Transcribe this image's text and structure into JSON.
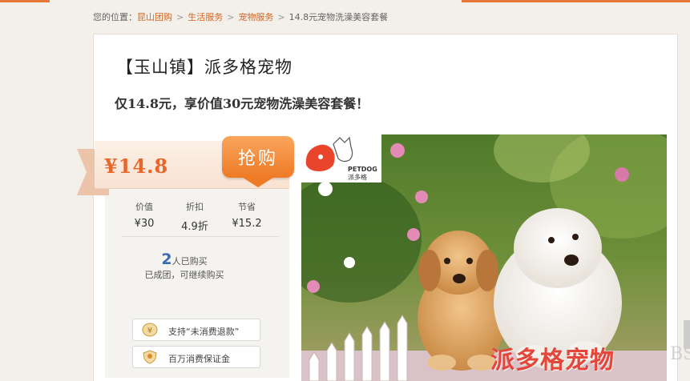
{
  "breadcrumb": {
    "prefix": "您的位置：",
    "items": [
      "昆山团购",
      "生活服务",
      "宠物服务"
    ],
    "current": "14.8元宠物洗澡美容套餐",
    "separator": ">"
  },
  "deal": {
    "shop_title": "【玉山镇】派多格宠物",
    "title": "仅14.8元，享价值30元宠物洗澡美容套餐！",
    "price": "¥14.8",
    "buy_label": "抢购"
  },
  "stats": {
    "value_label": "价值",
    "value": "¥30",
    "discount_label": "折扣",
    "discount": "4.9折",
    "save_label": "节省",
    "save": "¥15.2"
  },
  "buyers": {
    "count": "2",
    "count_label": "人已购买",
    "status": "已成团，可继续购买"
  },
  "guarantees": [
    {
      "icon": "yen-shield-icon",
      "label": "支持“未消费退款”"
    },
    {
      "icon": "hand-shield-icon",
      "label": "百万消费保证金"
    }
  ],
  "photo": {
    "logo_brand": "PETDOG",
    "logo_cn": "派多格",
    "watermark": "派多格宠物",
    "watermark2": "BS"
  },
  "colors": {
    "accent": "#e8773a",
    "price": "#e8662a",
    "link": "#d9641f",
    "count": "#3a6bb8"
  }
}
